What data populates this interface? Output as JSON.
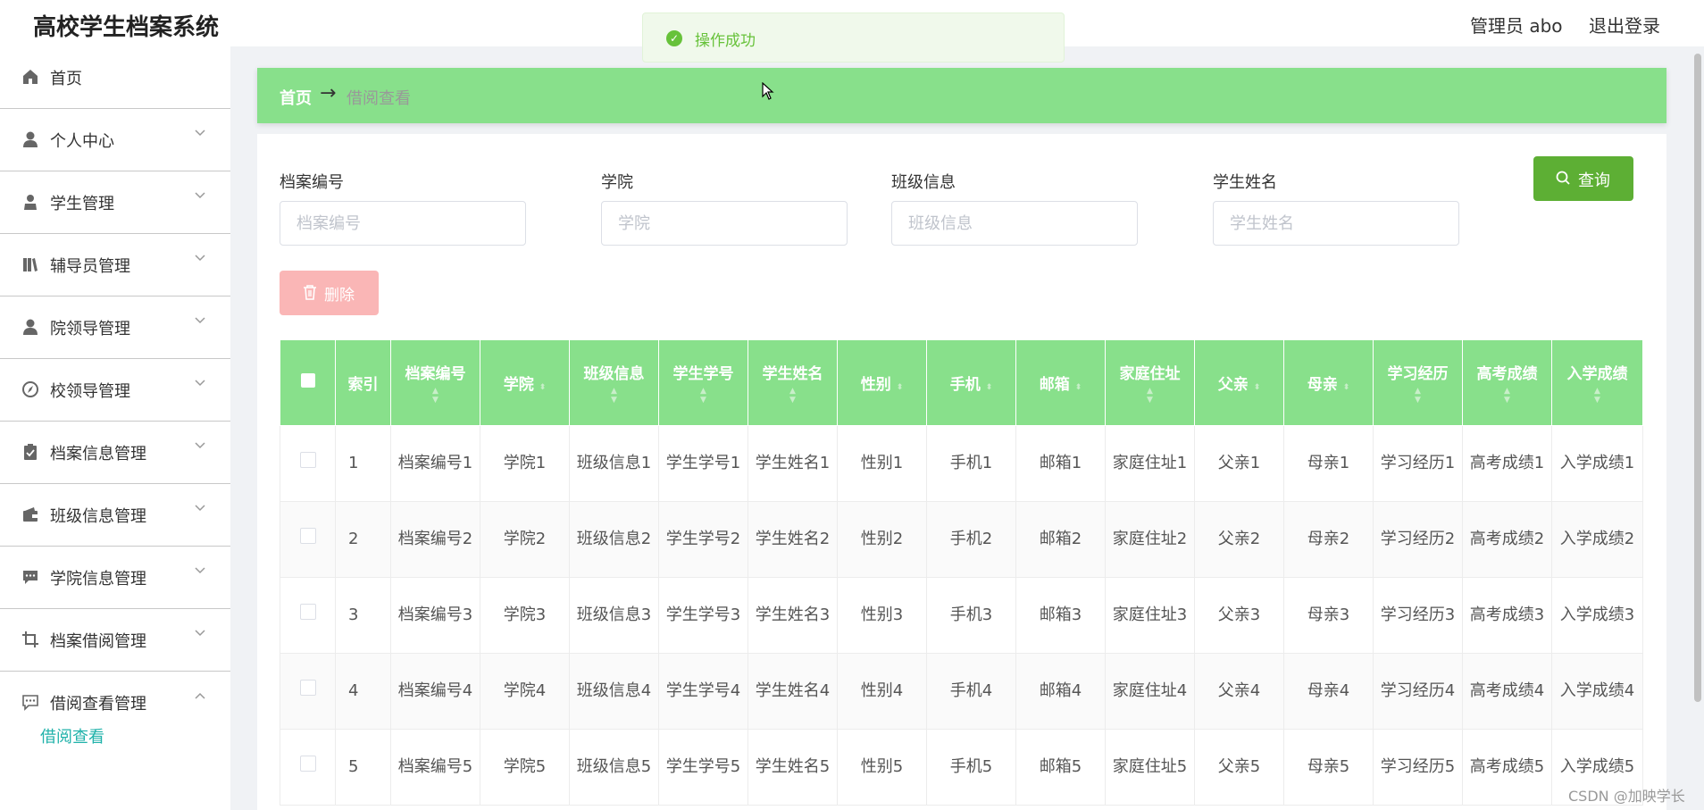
{
  "header": {
    "title": "高校学生档案系统",
    "user": "管理员 abo",
    "logout": "退出登录"
  },
  "toast": {
    "message": "操作成功"
  },
  "sidebar": {
    "items": [
      {
        "label": "首页",
        "icon": "home-icon"
      },
      {
        "label": "个人中心",
        "icon": "user-icon"
      },
      {
        "label": "学生管理",
        "icon": "student-icon"
      },
      {
        "label": "辅导员管理",
        "icon": "books-icon"
      },
      {
        "label": "院领导管理",
        "icon": "user-icon"
      },
      {
        "label": "校领导管理",
        "icon": "compass-icon"
      },
      {
        "label": "档案信息管理",
        "icon": "clipboard-icon"
      },
      {
        "label": "班级信息管理",
        "icon": "wallet-icon"
      },
      {
        "label": "学院信息管理",
        "icon": "chat-icon"
      },
      {
        "label": "档案借阅管理",
        "icon": "crop-icon"
      },
      {
        "label": "借阅查看管理",
        "icon": "chat-dots-icon"
      }
    ],
    "active_sub": "借阅查看"
  },
  "breadcrumb": {
    "home": "首页",
    "arrow": "→",
    "current": "借阅查看"
  },
  "search": {
    "fields": [
      {
        "label": "档案编号",
        "placeholder": "档案编号"
      },
      {
        "label": "学院",
        "placeholder": "学院"
      },
      {
        "label": "班级信息",
        "placeholder": "班级信息"
      },
      {
        "label": "学生姓名",
        "placeholder": "学生姓名"
      }
    ],
    "query_label": "查询",
    "delete_label": "删除"
  },
  "table": {
    "headers": [
      "索引",
      "档案编号",
      "学院",
      "班级信息",
      "学生学号",
      "学生姓名",
      "性别",
      "手机",
      "邮箱",
      "家庭住址",
      "父亲",
      "母亲",
      "学习经历",
      "高考成绩",
      "入学成绩"
    ],
    "rows": [
      [
        "1",
        "档案编号1",
        "学院1",
        "班级信息1",
        "学生学号1",
        "学生姓名1",
        "性别1",
        "手机1",
        "邮箱1",
        "家庭住址1",
        "父亲1",
        "母亲1",
        "学习经历1",
        "高考成绩1",
        "入学成绩1"
      ],
      [
        "2",
        "档案编号2",
        "学院2",
        "班级信息2",
        "学生学号2",
        "学生姓名2",
        "性别2",
        "手机2",
        "邮箱2",
        "家庭住址2",
        "父亲2",
        "母亲2",
        "学习经历2",
        "高考成绩2",
        "入学成绩2"
      ],
      [
        "3",
        "档案编号3",
        "学院3",
        "班级信息3",
        "学生学号3",
        "学生姓名3",
        "性别3",
        "手机3",
        "邮箱3",
        "家庭住址3",
        "父亲3",
        "母亲3",
        "学习经历3",
        "高考成绩3",
        "入学成绩3"
      ],
      [
        "4",
        "档案编号4",
        "学院4",
        "班级信息4",
        "学生学号4",
        "学生姓名4",
        "性别4",
        "手机4",
        "邮箱4",
        "家庭住址4",
        "父亲4",
        "母亲4",
        "学习经历4",
        "高考成绩4",
        "入学成绩4"
      ],
      [
        "5",
        "档案编号5",
        "学院5",
        "班级信息5",
        "学生学号5",
        "学生姓名5",
        "性别5",
        "手机5",
        "邮箱5",
        "家庭住址5",
        "父亲5",
        "母亲5",
        "学习经历5",
        "高考成绩5",
        "入学成绩5"
      ]
    ]
  },
  "watermark": "CSDN @加映学长",
  "colors": {
    "primary_green": "#88e08b",
    "query_button": "#5daf34",
    "delete_button": "#fab6b6",
    "sub_active": "#20b2aa",
    "toast_text": "#67c23a"
  }
}
